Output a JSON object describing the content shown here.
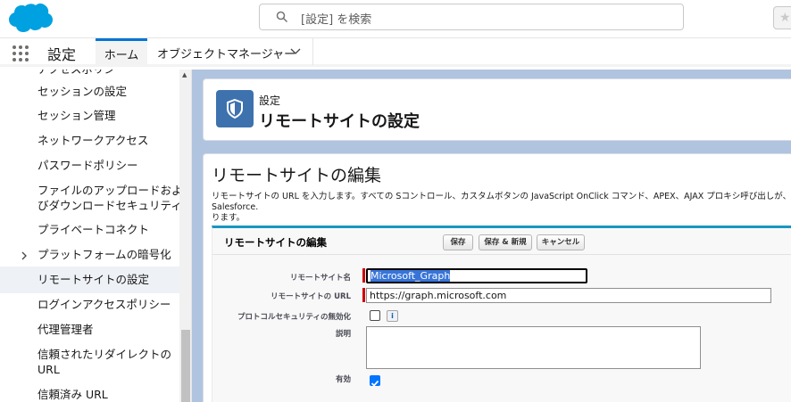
{
  "header": {
    "search_placeholder": "[設定] を検索"
  },
  "nav": {
    "app_name": "設定",
    "tabs": [
      {
        "label": "ホーム",
        "active": true
      },
      {
        "label": "オブジェクトマネージャー",
        "active": false
      }
    ]
  },
  "sidebar": {
    "items": [
      {
        "label": "アクセスポリシー"
      },
      {
        "label": "セッションの設定"
      },
      {
        "label": "セッション管理"
      },
      {
        "label": "ネットワークアクセス"
      },
      {
        "label": "パスワードポリシー"
      },
      {
        "label": "ファイルのアップロードおよ"
      },
      {
        "label": "びダウンロードセキュリティ"
      },
      {
        "label": "プライベートコネクト"
      },
      {
        "label": "プラットフォームの暗号化"
      },
      {
        "label": "リモートサイトの設定",
        "active": true
      },
      {
        "label": "ログインアクセスポリシー"
      },
      {
        "label": "代理管理者"
      },
      {
        "label": "信頼されたリダイレクトの"
      },
      {
        "label": "URL"
      },
      {
        "label": "信頼済み URL"
      }
    ]
  },
  "page_header": {
    "breadcrumb": "設定",
    "title": "リモートサイトの設定"
  },
  "edit": {
    "title": "リモートサイトの編集",
    "description_line1": "リモートサイトの URL を入力します。すべての Sコントロール、カスタムボタンの JavaScript OnClick コマンド、APEX、AJAX プロキシ呼び出しが、Salesforce.",
    "description_line2": "ります。",
    "block_title": "リモートサイトの編集",
    "buttons": {
      "save": "保存",
      "save_new": "保存 & 新規",
      "cancel": "キャンセル"
    },
    "fields": {
      "name_label": "リモートサイト名",
      "name_value": "Microsoft_Graph",
      "url_label": "リモートサイトの URL",
      "url_value": "https://graph.microsoft.com",
      "protocol_label": "プロトコルセキュリティの無効化",
      "protocol_checked": false,
      "desc_label": "説明",
      "desc_value": "",
      "active_label": "有効",
      "active_checked": true
    },
    "info_icon": "i"
  },
  "colors": {
    "brand_blue": "#00a1e0",
    "active_tab": "#0176d3",
    "icon_bg": "#3e72ae",
    "page_bg": "#b0c4df"
  }
}
